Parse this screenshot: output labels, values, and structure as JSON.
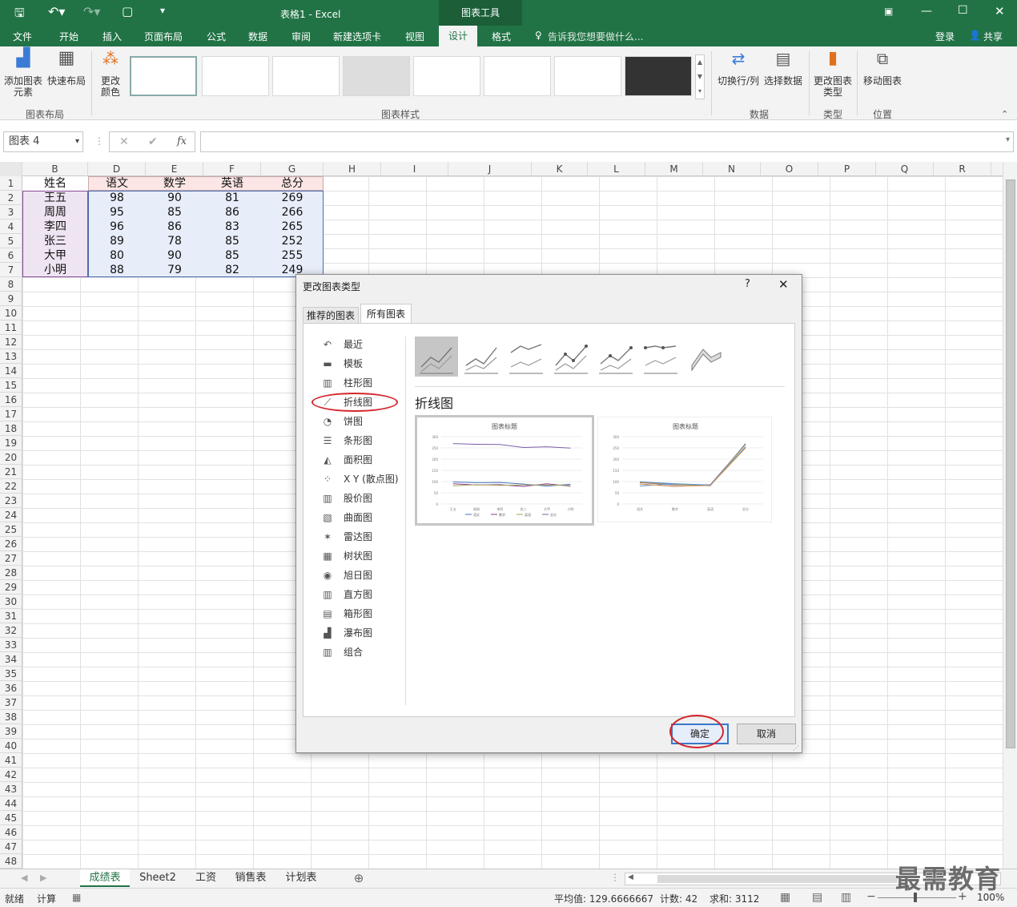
{
  "window": {
    "title": "表格1 - Excel",
    "context_tab": "图表工具"
  },
  "menu": {
    "items": [
      "文件",
      "开始",
      "插入",
      "页面布局",
      "公式",
      "数据",
      "审阅",
      "新建选项卡",
      "视图",
      "设计",
      "格式"
    ],
    "tell_me": "告诉我您想要做什么...",
    "login": "登录",
    "share": "共享"
  },
  "ribbon": {
    "add_element": "添加图表元素",
    "quick_layout": "快速布局",
    "change_color": "更改颜色",
    "group_layout": "图表布局",
    "group_styles": "图表样式",
    "switch_rowcol": "切换行/列",
    "select_data": "选择数据",
    "group_data": "数据",
    "change_type": "更改图表类型",
    "group_type": "类型",
    "move_chart": "移动图表",
    "group_location": "位置"
  },
  "formula_bar": {
    "name_box": "图表 4",
    "fx": "fx"
  },
  "columns": [
    "B",
    "D",
    "E",
    "F",
    "G",
    "H",
    "I",
    "J",
    "K",
    "L",
    "M",
    "N",
    "O",
    "P",
    "Q",
    "R"
  ],
  "rows": [
    "1",
    "2",
    "3",
    "4",
    "5",
    "6",
    "7",
    "8",
    "9",
    "10",
    "11",
    "12",
    "13",
    "14",
    "15",
    "16",
    "17",
    "18",
    "19",
    "20",
    "21",
    "22",
    "23",
    "24",
    "25",
    "26",
    "27",
    "28",
    "29",
    "30",
    "31",
    "32",
    "33",
    "34",
    "35",
    "36",
    "37",
    "38",
    "39",
    "40",
    "41",
    "42",
    "43",
    "44",
    "45",
    "46",
    "47",
    "48"
  ],
  "table": {
    "headers": [
      "姓名",
      "语文",
      "数学",
      "英语",
      "总分"
    ],
    "rows": [
      [
        "王五",
        "98",
        "90",
        "81",
        "269"
      ],
      [
        "周周",
        "95",
        "85",
        "86",
        "266"
      ],
      [
        "李四",
        "96",
        "86",
        "83",
        "265"
      ],
      [
        "张三",
        "89",
        "78",
        "85",
        "252"
      ],
      [
        "大甲",
        "80",
        "90",
        "85",
        "255"
      ],
      [
        "小明",
        "88",
        "79",
        "82",
        "249"
      ]
    ]
  },
  "dialog": {
    "title": "更改图表类型",
    "help": "?",
    "tabs": [
      "推荐的图表",
      "所有图表"
    ],
    "nav": [
      "最近",
      "模板",
      "柱形图",
      "折线图",
      "饼图",
      "条形图",
      "面积图",
      "X Y (散点图)",
      "股价图",
      "曲面图",
      "雷达图",
      "树状图",
      "旭日图",
      "直方图",
      "箱形图",
      "瀑布图",
      "组合"
    ],
    "section_title": "折线图",
    "preview_title": "图表标题",
    "preview1_x": [
      "王五",
      "周周",
      "李四",
      "张三",
      "大甲",
      "小明"
    ],
    "preview1_legend": [
      "语文",
      "数学",
      "英语",
      "总分"
    ],
    "preview2_x": [
      "语文",
      "数学",
      "英语",
      "总分"
    ],
    "preview_y": [
      "300",
      "250",
      "200",
      "150",
      "100",
      "50",
      "0"
    ],
    "ok": "确定",
    "cancel": "取消"
  },
  "sheets": [
    "成绩表",
    "Sheet2",
    "工资",
    "销售表",
    "计划表"
  ],
  "status": {
    "ready": "就绪",
    "calc": "计算",
    "average": "平均值: 129.6666667",
    "count": "计数: 42",
    "sum": "求和: 3112",
    "zoom": "100%"
  },
  "watermark": "最需教育"
}
